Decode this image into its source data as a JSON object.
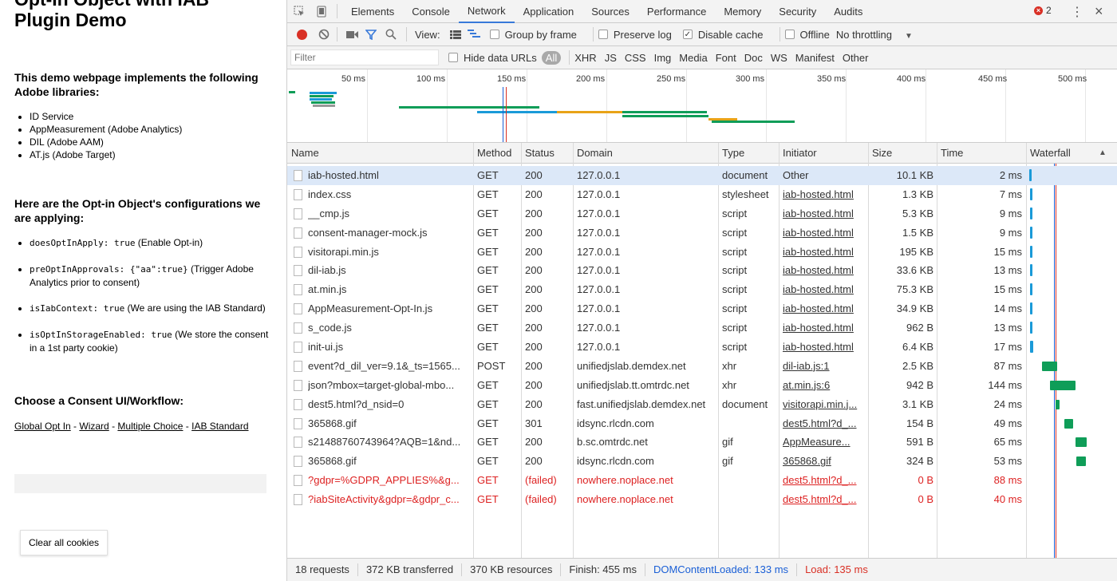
{
  "demo": {
    "title_line1": "Opt-In Object with IAB",
    "title_line2": "Plugin Demo",
    "intro_heading": "This demo webpage implements the following Adobe libraries:",
    "libraries": [
      "ID Service",
      "AppMeasurement (Adobe Analytics)",
      "DIL (Adobe AAM)",
      "AT.js (Adobe Target)"
    ],
    "config_heading": "Here are the Opt-in Object's configurations we are applying:",
    "configs": [
      {
        "code": "doesOptInApply: true",
        "desc": " (Enable Opt-in)"
      },
      {
        "code": "preOptInApprovals: {\"aa\":true}",
        "desc": " (Trigger Adobe Analytics prior to consent)"
      },
      {
        "code": "isIabContext: true",
        "desc": " (We are using the IAB Standard)"
      },
      {
        "code": "isOptInStorageEnabled: true",
        "desc": " (We store the consent in a 1st party cookie)"
      }
    ],
    "consent_heading": "Choose a Consent UI/Workflow:",
    "links": [
      "Global Opt In",
      "Wizard",
      "Multiple Choice",
      "IAB Standard"
    ],
    "link_separator": " - ",
    "clear_button": "Clear all cookies"
  },
  "devtools": {
    "tabs": [
      "Elements",
      "Console",
      "Network",
      "Application",
      "Sources",
      "Performance",
      "Memory",
      "Security",
      "Audits"
    ],
    "active_tab": "Network",
    "error_count": "2",
    "toolbar": {
      "view_label": "View:",
      "group_by_frame": "Group by frame",
      "preserve_log": "Preserve log",
      "disable_cache": "Disable cache",
      "offline": "Offline",
      "throttling": "No throttling"
    },
    "filter": {
      "placeholder": "Filter",
      "hide_data_urls": "Hide data URLs",
      "types": [
        "All",
        "XHR",
        "JS",
        "CSS",
        "Img",
        "Media",
        "Font",
        "Doc",
        "WS",
        "Manifest",
        "Other"
      ]
    },
    "overview_ticks": [
      "50 ms",
      "100 ms",
      "150 ms",
      "200 ms",
      "250 ms",
      "300 ms",
      "350 ms",
      "400 ms",
      "450 ms",
      "500 ms"
    ],
    "columns": [
      "Name",
      "Method",
      "Status",
      "Domain",
      "Type",
      "Initiator",
      "Size",
      "Time",
      "Waterfall"
    ],
    "requests": [
      {
        "name": "iab-hosted.html",
        "method": "GET",
        "status": "200",
        "domain": "127.0.0.1",
        "type": "document",
        "initiator": "Other",
        "size": "10.1 KB",
        "time": "2 ms",
        "wf_start": 0,
        "wf_dur": 2,
        "wf_color": "#1a9ad8",
        "failed": false,
        "selected": true,
        "init_link": false
      },
      {
        "name": "index.css",
        "method": "GET",
        "status": "200",
        "domain": "127.0.0.1",
        "type": "stylesheet",
        "initiator": "iab-hosted.html",
        "size": "1.3 KB",
        "time": "7 ms",
        "wf_start": 4,
        "wf_dur": 7,
        "wf_color": "#1a9ad8",
        "failed": false,
        "selected": false,
        "init_link": true
      },
      {
        "name": "__cmp.js",
        "method": "GET",
        "status": "200",
        "domain": "127.0.0.1",
        "type": "script",
        "initiator": "iab-hosted.html",
        "size": "5.3 KB",
        "time": "9 ms",
        "wf_start": 4,
        "wf_dur": 9,
        "wf_color": "#1a9ad8",
        "failed": false,
        "selected": false,
        "init_link": true
      },
      {
        "name": "consent-manager-mock.js",
        "method": "GET",
        "status": "200",
        "domain": "127.0.0.1",
        "type": "script",
        "initiator": "iab-hosted.html",
        "size": "1.5 KB",
        "time": "9 ms",
        "wf_start": 4,
        "wf_dur": 9,
        "wf_color": "#1a9ad8",
        "failed": false,
        "selected": false,
        "init_link": true
      },
      {
        "name": "visitorapi.min.js",
        "method": "GET",
        "status": "200",
        "domain": "127.0.0.1",
        "type": "script",
        "initiator": "iab-hosted.html",
        "size": "195 KB",
        "time": "15 ms",
        "wf_start": 4,
        "wf_dur": 15,
        "wf_color": "#1a9ad8",
        "failed": false,
        "selected": false,
        "init_link": true
      },
      {
        "name": "dil-iab.js",
        "method": "GET",
        "status": "200",
        "domain": "127.0.0.1",
        "type": "script",
        "initiator": "iab-hosted.html",
        "size": "33.6 KB",
        "time": "13 ms",
        "wf_start": 4,
        "wf_dur": 13,
        "wf_color": "#1a9ad8",
        "failed": false,
        "selected": false,
        "init_link": true
      },
      {
        "name": "at.min.js",
        "method": "GET",
        "status": "200",
        "domain": "127.0.0.1",
        "type": "script",
        "initiator": "iab-hosted.html",
        "size": "75.3 KB",
        "time": "15 ms",
        "wf_start": 4,
        "wf_dur": 15,
        "wf_color": "#1a9ad8",
        "failed": false,
        "selected": false,
        "init_link": true
      },
      {
        "name": "AppMeasurement-Opt-In.js",
        "method": "GET",
        "status": "200",
        "domain": "127.0.0.1",
        "type": "script",
        "initiator": "iab-hosted.html",
        "size": "34.9 KB",
        "time": "14 ms",
        "wf_start": 4,
        "wf_dur": 14,
        "wf_color": "#1a9ad8",
        "failed": false,
        "selected": false,
        "init_link": true
      },
      {
        "name": "s_code.js",
        "method": "GET",
        "status": "200",
        "domain": "127.0.0.1",
        "type": "script",
        "initiator": "iab-hosted.html",
        "size": "962 B",
        "time": "13 ms",
        "wf_start": 4,
        "wf_dur": 13,
        "wf_color": "#1a9ad8",
        "failed": false,
        "selected": false,
        "init_link": true
      },
      {
        "name": "init-ui.js",
        "method": "GET",
        "status": "200",
        "domain": "127.0.0.1",
        "type": "script",
        "initiator": "iab-hosted.html",
        "size": "6.4 KB",
        "time": "17 ms",
        "wf_start": 4,
        "wf_dur": 17,
        "wf_color": "#1a9ad8",
        "failed": false,
        "selected": false,
        "init_link": true
      },
      {
        "name": "event?d_dil_ver=9.1&_ts=1565...",
        "method": "POST",
        "status": "200",
        "domain": "unifiedjslab.demdex.net",
        "type": "xhr",
        "initiator": "dil-iab.js:1",
        "size": "2.5 KB",
        "time": "87 ms",
        "wf_start": 80,
        "wf_dur": 87,
        "wf_color": "#0f9d58",
        "failed": false,
        "selected": false,
        "init_link": true
      },
      {
        "name": "json?mbox=target-global-mbo...",
        "method": "GET",
        "status": "200",
        "domain": "unifiedjslab.tt.omtrdc.net",
        "type": "xhr",
        "initiator": "at.min.js:6",
        "size": "942 B",
        "time": "144 ms",
        "wf_start": 128,
        "wf_dur": 144,
        "wf_color": "#0f9d58",
        "failed": false,
        "selected": false,
        "init_link": true
      },
      {
        "name": "dest5.html?d_nsid=0",
        "method": "GET",
        "status": "200",
        "domain": "fast.unifiedjslab.demdex.net",
        "type": "document",
        "initiator": "visitorapi.min.j...",
        "size": "3.1 KB",
        "time": "24 ms",
        "wf_start": 164,
        "wf_dur": 24,
        "wf_color": "#0f9d58",
        "failed": false,
        "selected": false,
        "init_link": true
      },
      {
        "name": "365868.gif",
        "method": "GET",
        "status": "301",
        "domain": "idsync.rlcdn.com",
        "type": "",
        "initiator": "dest5.html?d_...",
        "size": "154 B",
        "time": "49 ms",
        "wf_start": 220,
        "wf_dur": 49,
        "wf_color": "#0f9d58",
        "failed": false,
        "selected": false,
        "init_link": true
      },
      {
        "name": "s21488760743964?AQB=1&nd...",
        "method": "GET",
        "status": "200",
        "domain": "b.sc.omtrdc.net",
        "type": "gif",
        "initiator": "AppMeasure...",
        "size": "591 B",
        "time": "65 ms",
        "wf_start": 290,
        "wf_dur": 65,
        "wf_color": "#0f9d58",
        "failed": false,
        "selected": false,
        "init_link": true
      },
      {
        "name": "365868.gif",
        "method": "GET",
        "status": "200",
        "domain": "idsync.rlcdn.com",
        "type": "gif",
        "initiator": "365868.gif",
        "size": "324 B",
        "time": "53 ms",
        "wf_start": 294,
        "wf_dur": 53,
        "wf_color": "#0f9d58",
        "failed": false,
        "selected": false,
        "init_link": true
      },
      {
        "name": "?gdpr=%GDPR_APPLIES%&g...",
        "method": "GET",
        "status": "(failed)",
        "domain": "nowhere.noplace.net",
        "type": "",
        "initiator": "dest5.html?d_...",
        "size": "0 B",
        "time": "88 ms",
        "wf_start": 0,
        "wf_dur": 0,
        "wf_color": "",
        "failed": true,
        "selected": false,
        "init_link": true
      },
      {
        "name": "?iabSiteActivity&gdpr=&gdpr_c...",
        "method": "GET",
        "status": "(failed)",
        "domain": "nowhere.noplace.net",
        "type": "",
        "initiator": "dest5.html?d_...",
        "size": "0 B",
        "time": "40 ms",
        "wf_start": 0,
        "wf_dur": 0,
        "wf_color": "",
        "failed": true,
        "selected": false,
        "init_link": true
      }
    ],
    "status": {
      "requests": "18 requests",
      "transferred": "372 KB transferred",
      "resources": "370 KB resources",
      "finish": "Finish: 455 ms",
      "dom_content_loaded": "DOMContentLoaded: 133 ms",
      "load": "Load: 135 ms"
    },
    "colors": {
      "accent": "#3879d9",
      "dom_content_loaded": "#1a5fd6",
      "load": "#d93025",
      "error": "#dd2222",
      "selected_row": "#dce8f8"
    }
  }
}
